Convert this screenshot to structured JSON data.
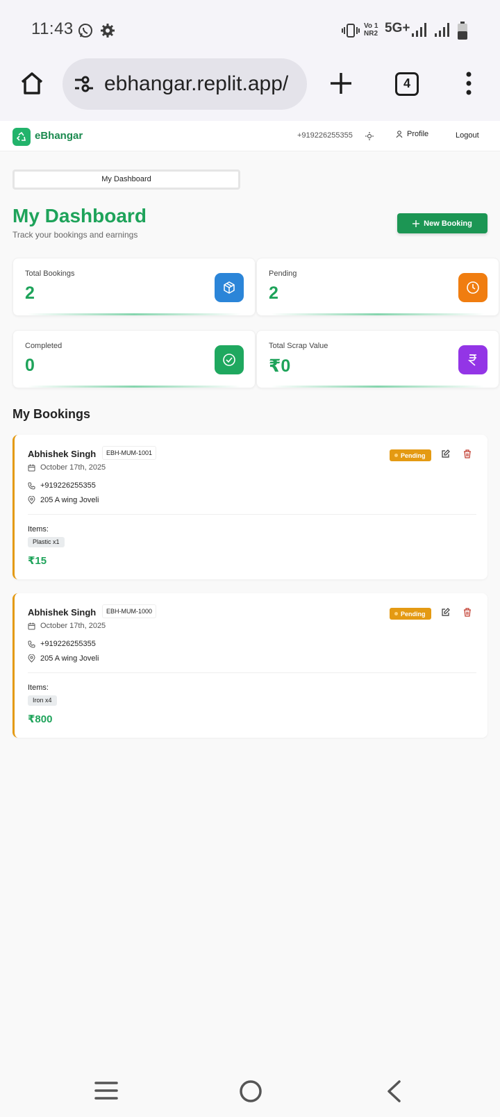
{
  "status_bar": {
    "time": "11:43",
    "volte_line1": "Vo 1",
    "volte_line2": "NR2",
    "network": "5G+",
    "icons": [
      "whatsapp-icon",
      "settings-icon",
      "vibrate-icon",
      "signal-icon",
      "battery-icon"
    ]
  },
  "browser": {
    "url": "ebhangar.replit.app/",
    "tab_count": "4"
  },
  "header": {
    "brand": "eBhangar",
    "phone": "+919226255355",
    "profile_label": "Profile",
    "logout_label": "Logout"
  },
  "tab": {
    "label": "My Dashboard"
  },
  "page": {
    "title": "My Dashboard",
    "subtitle": "Track your bookings and earnings",
    "new_booking_label": "New Booking"
  },
  "stats": [
    {
      "label": "Total Bookings",
      "value": "2",
      "icon": "box-icon",
      "color": "#2b85d8"
    },
    {
      "label": "Pending",
      "value": "2",
      "icon": "clock-icon",
      "color": "#f07d10"
    },
    {
      "label": "Completed",
      "value": "0",
      "icon": "check-circle-icon",
      "color": "#1fa85f"
    },
    {
      "label": "Total Scrap Value",
      "value": "₹0",
      "icon": "rupee-icon",
      "color": "#9335e6"
    }
  ],
  "bookings_section": {
    "title": "My Bookings"
  },
  "bookings": [
    {
      "name": "Abhishek Singh",
      "code": "EBH-MUM-1001",
      "status": "Pending",
      "date": "October 17th, 2025",
      "phone": "+919226255355",
      "address": "205 A wing Joveli",
      "items_label": "Items:",
      "items": [
        "Plastic x1"
      ],
      "amount": "₹15"
    },
    {
      "name": "Abhishek Singh",
      "code": "EBH-MUM-1000",
      "status": "Pending",
      "date": "October 17th, 2025",
      "phone": "+919226255355",
      "address": "205 A wing Joveli",
      "items_label": "Items:",
      "items": [
        "Iron x4"
      ],
      "amount": "₹800"
    }
  ],
  "colors": {
    "brand_green": "#1ea35a",
    "button_green": "#1c9654",
    "pending_orange": "#e49a13",
    "delete_red": "#c0392b"
  }
}
